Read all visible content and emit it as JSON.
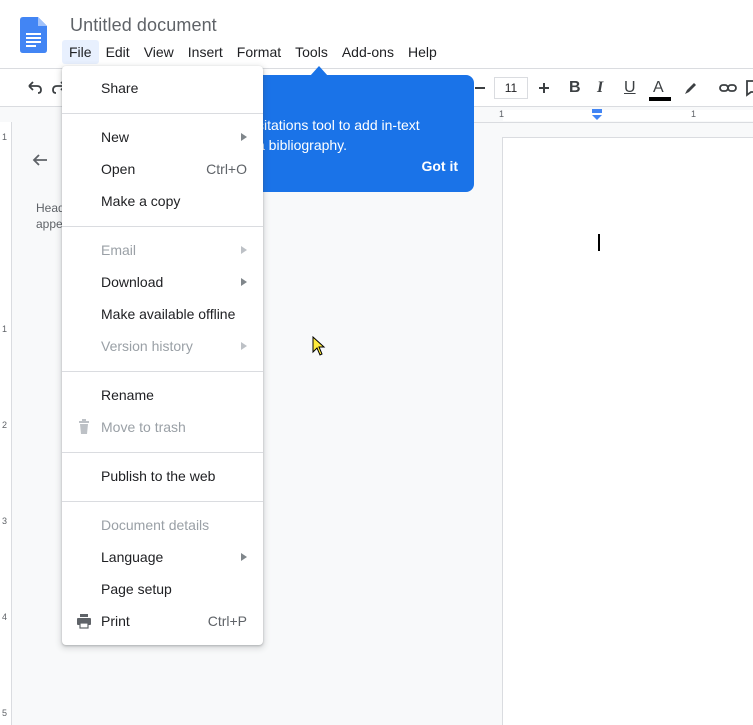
{
  "app": {
    "doc_title": "Untitled document"
  },
  "menubar": {
    "items": [
      {
        "label": "File",
        "active": true
      },
      {
        "label": "Edit"
      },
      {
        "label": "View"
      },
      {
        "label": "Insert"
      },
      {
        "label": "Format"
      },
      {
        "label": "Tools"
      },
      {
        "label": "Add-ons"
      },
      {
        "label": "Help"
      }
    ]
  },
  "toolbar": {
    "font_size": "11",
    "bold": "B",
    "italic": "I",
    "underline": "U",
    "text_color": "A",
    "text_color_value": "#000000"
  },
  "ruler": {
    "h_numbers": [
      "1",
      "1"
    ],
    "v_numbers": [
      "1",
      "1",
      "2",
      "3",
      "4",
      "5"
    ]
  },
  "outline": {
    "text_line1": "Head",
    "text_line2": "appe"
  },
  "tooltip": {
    "text_line1": "citations tool to add in-text",
    "text_line2": "a bibliography.",
    "button": "Got it",
    "color": "#1a73e8"
  },
  "file_menu": {
    "items": [
      {
        "label": "Share"
      },
      {
        "label": "New",
        "submenu": true
      },
      {
        "label": "Open",
        "shortcut": "Ctrl+O"
      },
      {
        "label": "Make a copy"
      },
      {
        "label": "Email",
        "submenu": true,
        "disabled": true
      },
      {
        "label": "Download",
        "submenu": true
      },
      {
        "label": "Make available offline"
      },
      {
        "label": "Version history",
        "submenu": true,
        "disabled": true
      },
      {
        "label": "Rename"
      },
      {
        "label": "Move to trash",
        "disabled": true,
        "icon": "trash-icon"
      },
      {
        "label": "Publish to the web"
      },
      {
        "label": "Document details",
        "disabled": true
      },
      {
        "label": "Language",
        "submenu": true
      },
      {
        "label": "Page setup"
      },
      {
        "label": "Print",
        "shortcut": "Ctrl+P",
        "icon": "print-icon"
      }
    ]
  },
  "colors": {
    "accent": "#1a73e8",
    "menu_active_bg": "#e8f0fe",
    "doc_icon": "#4285f4"
  }
}
